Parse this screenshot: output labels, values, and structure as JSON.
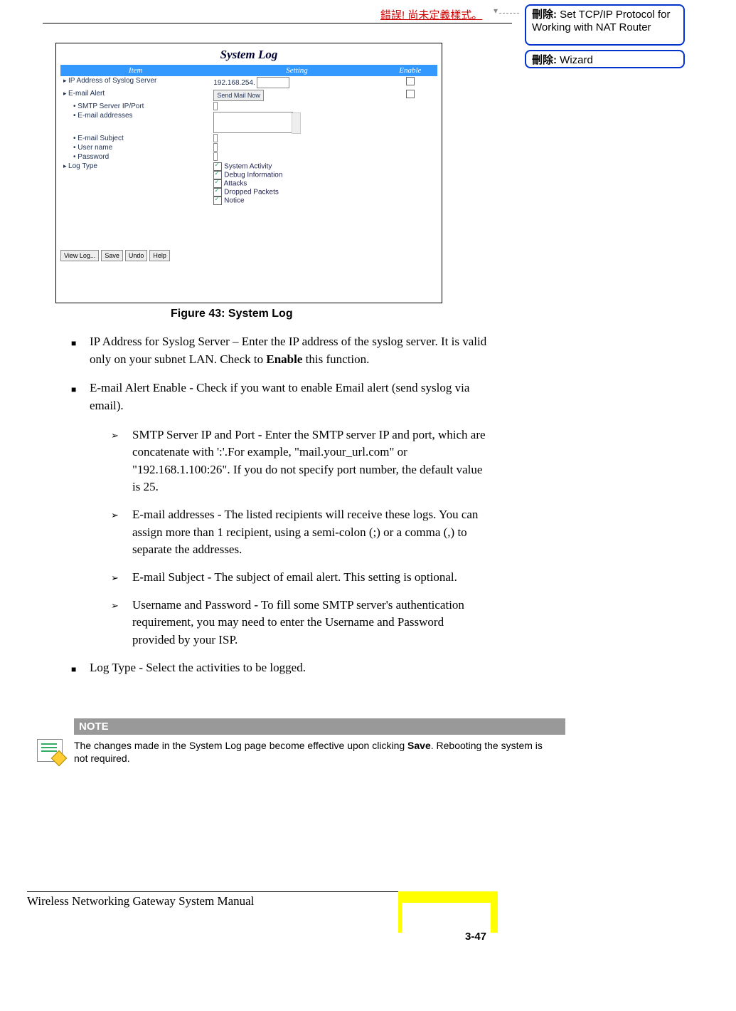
{
  "header": {
    "error_text": "錯誤! 尚未定義樣式。"
  },
  "comments": {
    "del_label": "刪除:",
    "comment1_text": "Set TCP/IP Protocol for Working with NAT Router",
    "comment2_text": "Wizard"
  },
  "screenshot": {
    "title": "System Log",
    "headers": {
      "item": "Item",
      "setting": "Setting",
      "enable": "Enable"
    },
    "rows": {
      "ip_label": "IP Address of Syslog Server",
      "ip_prefix": "192.168.254.",
      "email_alert": "E-mail Alert",
      "send_mail_btn": "Send Mail Now",
      "smtp_label": "SMTP Server IP/Port",
      "email_addr_label": "E-mail addresses",
      "email_subject_label": "E-mail Subject",
      "username_label": "User name",
      "password_label": "Password",
      "logtype_label": "Log Type",
      "logtypes": [
        "System Activity",
        "Debug Information",
        "Attacks",
        "Dropped Packets",
        "Notice"
      ]
    },
    "buttons": {
      "viewlog": "View Log...",
      "save": "Save",
      "undo": "Undo",
      "help": "Help"
    }
  },
  "figure_caption": "Figure 43: System Log",
  "content": {
    "bullet1a": "IP Address for Syslog Server – Enter the IP address of the syslog server. It is valid only on your subnet LAN. Check to ",
    "bullet1_bold": "Enable",
    "bullet1b": " this function.",
    "bullet2": "E-mail Alert Enable - Check if you want to enable Email alert (send syslog via email).",
    "sub1": "SMTP Server IP and Port - Enter the SMTP server IP and port, which are concatenate with ':'.For example, \"mail.your_url.com\" or \"192.168.1.100:26\". If you do not specify port number, the default value is 25.",
    "sub2": "E-mail addresses - The listed recipients will receive these logs. You can assign more than 1 recipient, using a semi-colon (;) or a comma (,) to separate the addresses.",
    "sub3": "E-mail Subject - The subject of email alert. This setting is optional.",
    "sub4": "Username and Password - To fill some SMTP server's authentication requirement, you may need to enter the Username and Password provided by your ISP.",
    "bullet3": "Log Type - Select the activities to be logged."
  },
  "note": {
    "header": "NOTE",
    "text_a": "The changes made in the System Log page become effective upon clicking ",
    "text_bold": "Save",
    "text_b": ". Rebooting the system is not required."
  },
  "footer": {
    "title": "Wireless Networking Gateway System Manual",
    "page": "3-47"
  }
}
